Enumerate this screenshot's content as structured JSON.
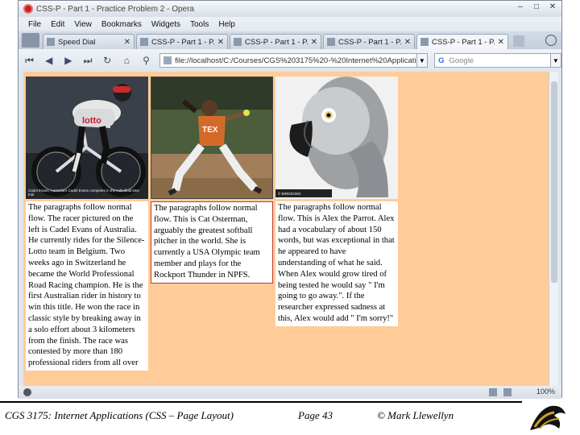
{
  "window": {
    "title": "CSS-P - Part 1 - Practice Problem 2 - Opera",
    "menu": [
      "File",
      "Edit",
      "View",
      "Bookmarks",
      "Widgets",
      "Tools",
      "Help"
    ]
  },
  "tabs": [
    {
      "label": "Speed Dial",
      "active": false
    },
    {
      "label": "CSS-P - Part 1 - P...",
      "active": false
    },
    {
      "label": "CSS-P - Part 1 - P...",
      "active": false
    },
    {
      "label": "CSS-P - Part 1 - P...",
      "active": false
    },
    {
      "label": "CSS-P - Part 1 - P...",
      "active": true
    }
  ],
  "navbar": {
    "address": "file://localhost/C:/Courses/CGS%203175%20-%20Internet%20Applications/",
    "search_placeholder": "Google",
    "search_engine_letter": "G"
  },
  "page": {
    "background": "#ffcc99",
    "columns": [
      {
        "image_alt": "cyclist",
        "caption": "Cadel Evans, Australia's Cadel Evans competes in the individual time trial",
        "text": "The paragraphs follow normal flow. The racer pictured on the left is Cadel Evans of Australia. He currently rides for the Silence-Lotto team in Belgium. Two weeks ago in Switzerland he became the World Professional Road Racing champion. He is the first Australian rider in history to win this title. He won the race in classic style by breaking away in a solo effort about 3 kilometers from the finish. The race was contested by more than 180 professional riders from all over"
      },
      {
        "image_alt": "softball pitcher",
        "caption": "",
        "text": "The paragraphs follow normal flow. This is Cat Osterman, arguably the greatest softball pitcher in the world. She is currently a USA Olympic team member and plays for the Rockport Thunder in NPFS."
      },
      {
        "image_alt": "parrot",
        "caption": "© BIRDSONG",
        "text": "The paragraphs follow normal flow. This is Alex the Parrot. Alex had a vocabulary of about 150 words, but was exceptional in that he appeared to have understanding of what he said. When Alex would grow tired of being tested he would say \" I'm going to go away.\". If the researcher expressed sadness at this, Alex would add \" I'm sorry!\""
      }
    ]
  },
  "statusbar": {
    "zoom": "100%"
  },
  "footer": {
    "course": "CGS 3175: Internet Applications (CSS – Page Layout)",
    "page": "Page 43",
    "author": "© Mark Llewellyn"
  },
  "colors": {
    "accent": "#ffcc99",
    "opera_red": "#cc1f1f"
  }
}
